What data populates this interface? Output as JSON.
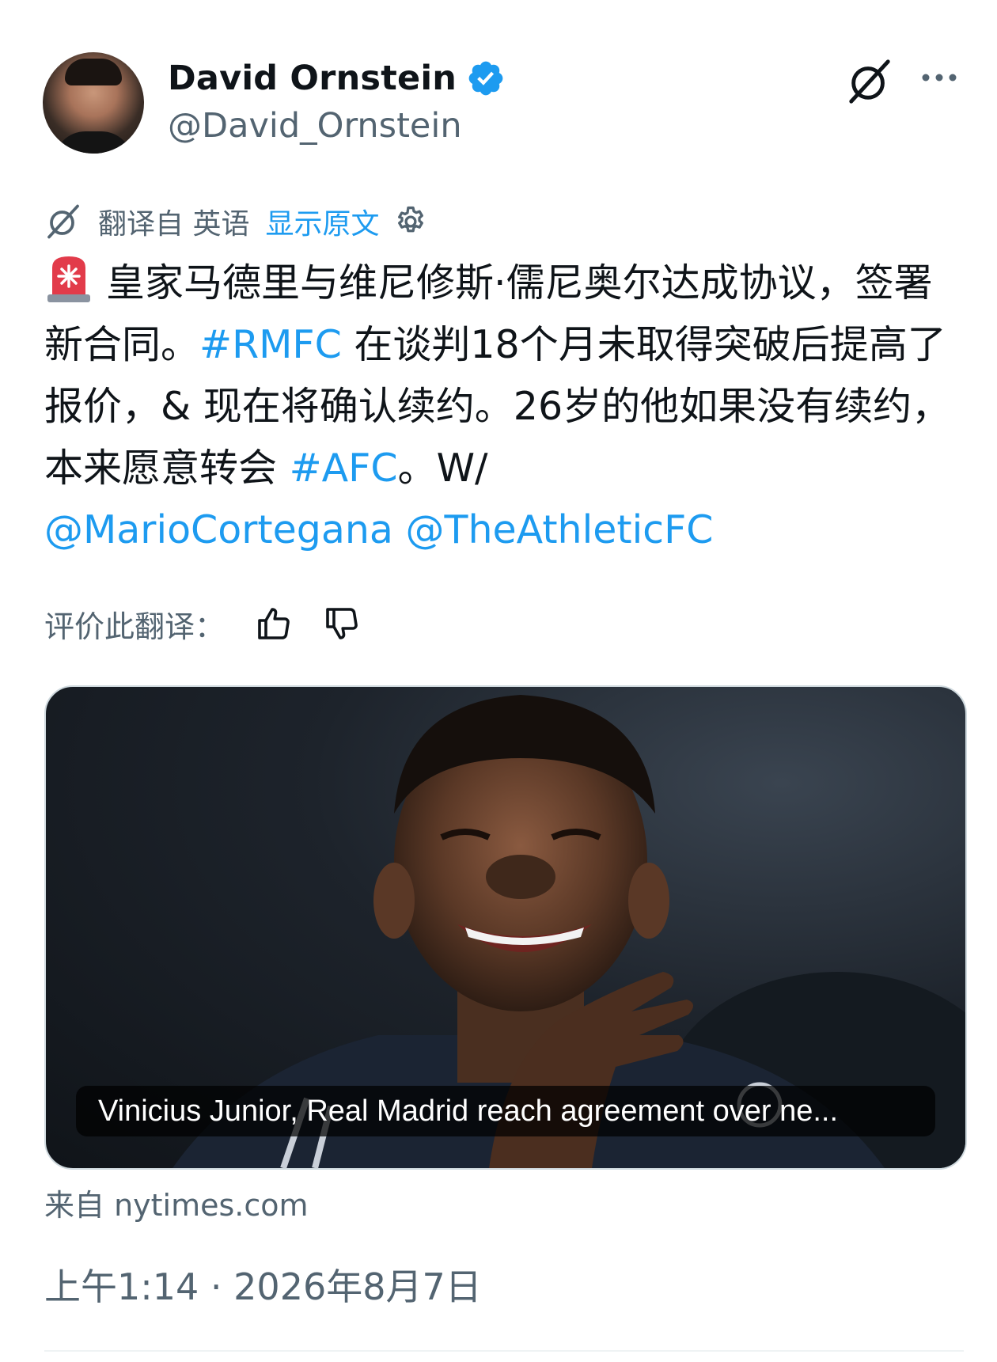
{
  "author": {
    "name": "David Ornstein",
    "handle": "@David_Ornstein",
    "verified": true,
    "verified_color": "#1d9bf0"
  },
  "header_icons": [
    "grok-icon",
    "more-icon"
  ],
  "translation_bar": {
    "translated_from": "翻译自 英语",
    "show_original": "显示原文"
  },
  "tweet": {
    "emoji": "siren",
    "text_1": "皇家马德里与维尼修斯·儒尼奥尔达成协议，签署新合同。",
    "hashtag_1": "#RMFC",
    "text_2": " 在谈判18个月未取得突破后提高了报价，& 现在将确认续约。26岁的他如果没有续约，本来愿意转会 ",
    "hashtag_2": "#AFC",
    "text_3": "。W/ ",
    "mention_1": "@MarioCortegana",
    "mention_2": "@TheAthleticFC"
  },
  "rate_translation": {
    "label": "评价此翻译："
  },
  "media": {
    "caption": "Vinicius Junior, Real Madrid reach agreement over ne..."
  },
  "source_text": "来自 nytimes.com",
  "timestamp": "上午1:14 · 2026年8月7日",
  "colors": {
    "link": "#1d9bf0",
    "secondary_text": "#536471",
    "primary_text": "#0f1419"
  }
}
